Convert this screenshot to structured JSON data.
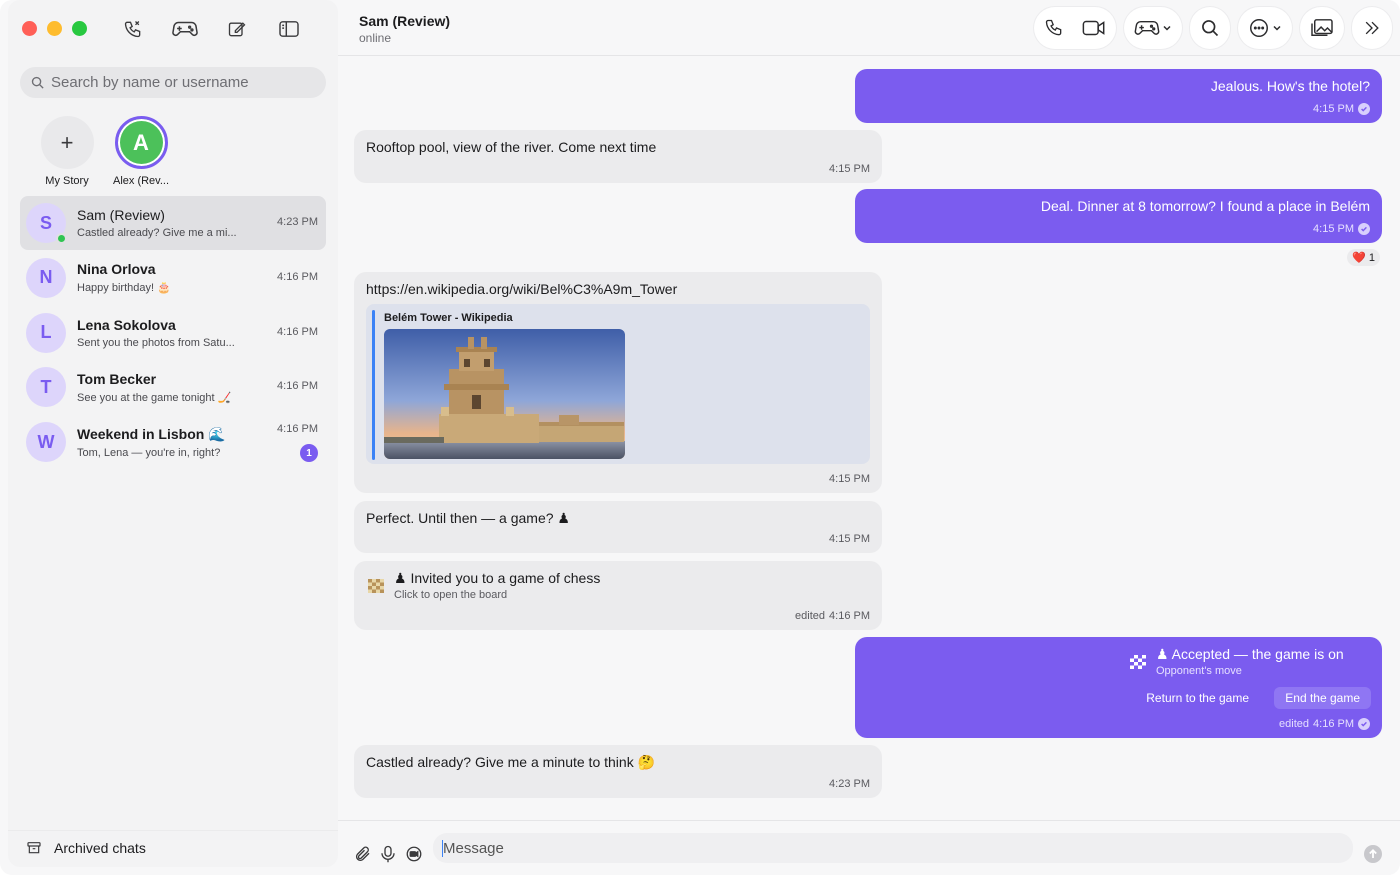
{
  "colors": {
    "accent": "#7b5cef",
    "online": "#30c552",
    "avatar_bg": "#ddd5fb"
  },
  "sidebar": {
    "search_placeholder": "Search by name or username",
    "stories": [
      {
        "label": "My Story",
        "icon": "plus-icon"
      },
      {
        "label": "Alex (Rev...",
        "initial": "A"
      }
    ],
    "chats": [
      {
        "initial": "S",
        "name": "Sam (Review)",
        "preview": "Castled already? Give me a mi...",
        "time": "4:23 PM",
        "active": true,
        "online": true
      },
      {
        "initial": "N",
        "name": "Nina Orlova",
        "preview": "Happy birthday! 🎂",
        "time": "4:16 PM"
      },
      {
        "initial": "L",
        "name": "Lena Sokolova",
        "preview": "Sent you the photos from Satu...",
        "time": "4:16 PM"
      },
      {
        "initial": "T",
        "name": "Tom Becker",
        "preview": "See you at the game tonight 🏒",
        "time": "4:16 PM"
      },
      {
        "initial": "W",
        "name": "Weekend in Lisbon 🌊",
        "preview": "Tom, Lena — you're in, right?",
        "time": "4:16 PM",
        "unread": "1"
      }
    ],
    "archived_label": "Archived chats"
  },
  "header": {
    "title": "Sam (Review)",
    "status": "online"
  },
  "messages": {
    "m1": {
      "text": "Jealous. How's the hotel?",
      "time": "4:15 PM"
    },
    "m2": {
      "text": "Rooftop pool, view of the river. Come next time",
      "time": "4:15 PM"
    },
    "m3": {
      "text": "Deal. Dinner at 8 tomorrow? I found a place in Belém",
      "time": "4:15 PM",
      "reaction": "❤️",
      "reaction_count": "1"
    },
    "m4": {
      "text": "https://en.wikipedia.org/wiki/Bel%C3%A9m_Tower",
      "card_title": "Belém Tower - Wikipedia",
      "time": "4:15 PM"
    },
    "m5": {
      "text": "Perfect. Until then — a game? ♟",
      "time": "4:15 PM"
    },
    "m6": {
      "text": "♟ Invited you to a game of chess",
      "sub": "Click to open the board",
      "edited": "edited",
      "time": "4:16 PM"
    },
    "m7": {
      "text": "♟ Accepted — the game is on",
      "sub": "Opponent's move",
      "return_label": "Return to the game",
      "end_label": "End the game",
      "edited": "edited",
      "time": "4:16 PM"
    },
    "m8": {
      "text": "Castled already? Give me a minute to think 🤔",
      "time": "4:23 PM"
    }
  },
  "composer": {
    "placeholder": "Message"
  }
}
